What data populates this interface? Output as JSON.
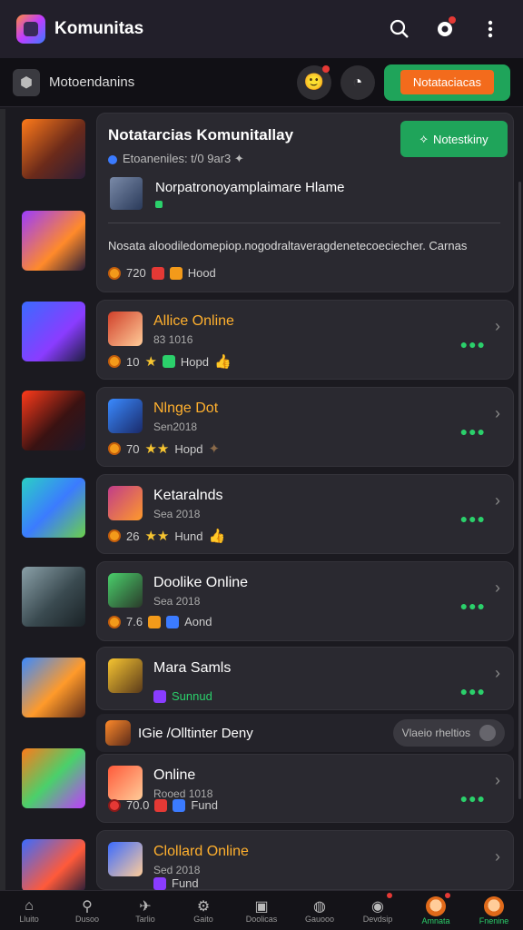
{
  "appbar": {
    "title": "Komunitas"
  },
  "subbar": {
    "title": "Motoendanins",
    "button_label": "Notataciacas"
  },
  "featured": {
    "title": "Notatarcias Komunitallay",
    "subtitle": "Etoaneniles: t/0 9ar3 ✦",
    "button_label": "Notestkiny",
    "game_name": "Norpatronoyamplaimare Hlame",
    "description": "Nosata aloodiledomepiop.nogodraltaveragdenetecoeciecher. Carnas",
    "stats": {
      "coins": "720",
      "label": "Hood"
    }
  },
  "rows": [
    {
      "title": "Allice Online",
      "subtitle": "83 1016",
      "coins": "10",
      "label": "Hopd",
      "title_color": "#ffb02e"
    },
    {
      "title": "Nlnge Dot",
      "subtitle": "Sen2018",
      "coins": "70",
      "label": "Hopd",
      "title_color": "#ffb02e"
    },
    {
      "title": "Ketaralnds",
      "subtitle": "Sea 2018",
      "coins": "26",
      "label": "Hund",
      "title_color": "#ffffff"
    },
    {
      "title": "Doolike Online",
      "subtitle": "Sea 2018",
      "coins": "7.6",
      "label": "Aond",
      "title_color": "#ffffff"
    },
    {
      "title": "Mara Samls",
      "subtitle": "",
      "coins": "",
      "label": "Sunnud",
      "title_color": "#ffffff"
    }
  ],
  "section": {
    "title": "IGie /Olltinter Deny",
    "toggle_label": "Vlaeio rheltios"
  },
  "rows2": [
    {
      "title": "Online",
      "subtitle": "Rooed 1018",
      "coins": "70.0",
      "label": "Fund",
      "title_color": "#ffffff"
    },
    {
      "title": "Clollard Online",
      "subtitle": "Sed 2018",
      "coins": "",
      "label": "Fund",
      "title_color": "#ffb02e"
    }
  ],
  "bottomnav": [
    {
      "label": "Lluito",
      "icon": "home-icon"
    },
    {
      "label": "Dusoo",
      "icon": "search-icon"
    },
    {
      "label": "Tarlio",
      "icon": "plane-icon"
    },
    {
      "label": "Gaito",
      "icon": "gear-icon"
    },
    {
      "label": "Doolicas",
      "icon": "box-icon"
    },
    {
      "label": "Gauooo",
      "icon": "compass-icon"
    },
    {
      "label": "Devdsip",
      "icon": "bomb-icon"
    },
    {
      "label": "Amnata",
      "icon": "avatar-icon"
    },
    {
      "label": "Fnenine",
      "icon": "avatar-icon"
    }
  ]
}
